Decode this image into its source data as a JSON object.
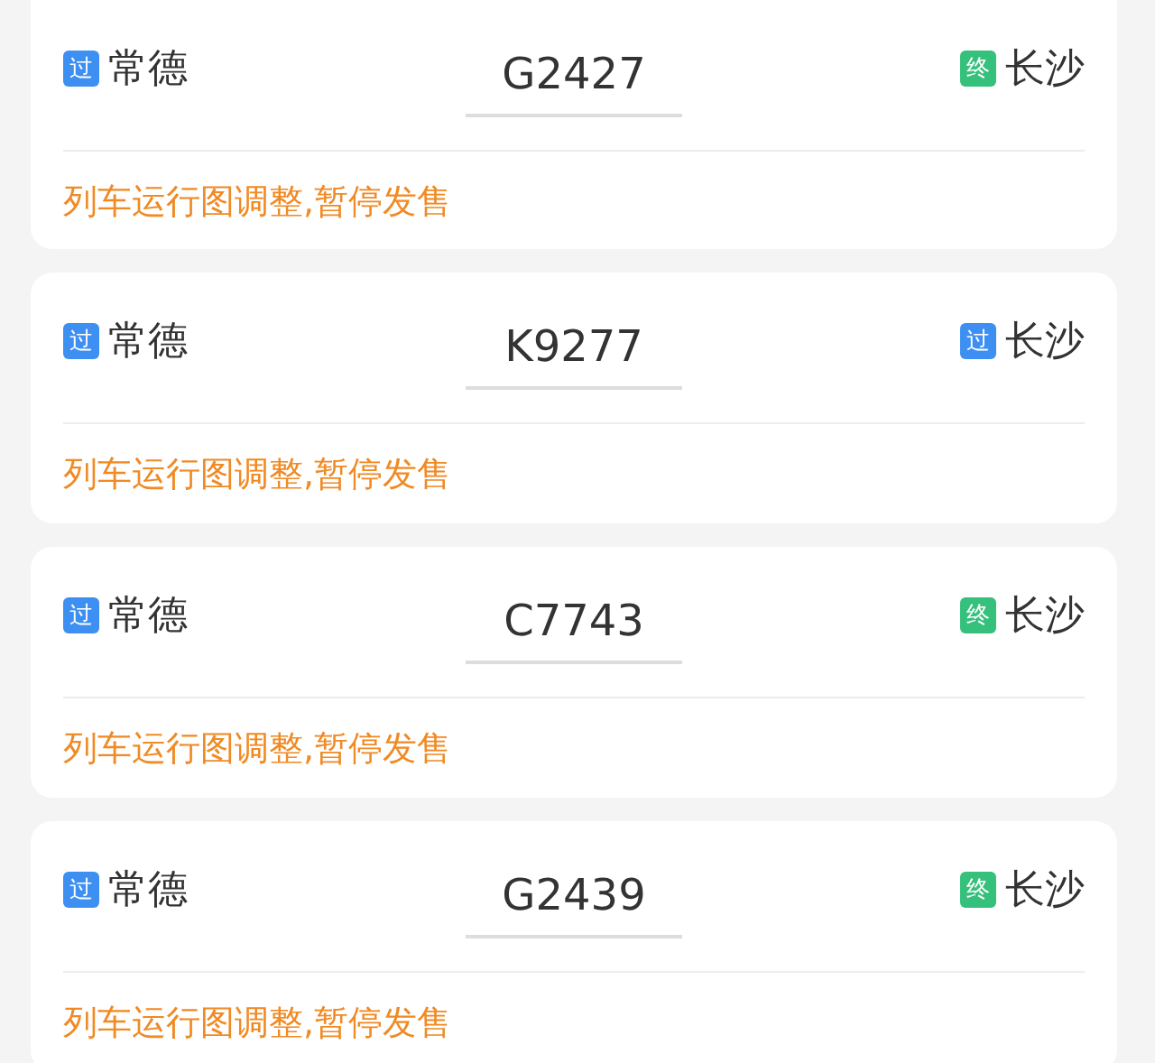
{
  "trains": [
    {
      "from": {
        "badge": "过",
        "kind": "pass",
        "station": "常德"
      },
      "number": "G2427",
      "to": {
        "badge": "终",
        "kind": "terminal",
        "station": "长沙"
      },
      "notice": "列车运行图调整,暂停发售"
    },
    {
      "from": {
        "badge": "过",
        "kind": "pass",
        "station": "常德"
      },
      "number": "K9277",
      "to": {
        "badge": "过",
        "kind": "pass",
        "station": "长沙"
      },
      "notice": "列车运行图调整,暂停发售"
    },
    {
      "from": {
        "badge": "过",
        "kind": "pass",
        "station": "常德"
      },
      "number": "C7743",
      "to": {
        "badge": "终",
        "kind": "terminal",
        "station": "长沙"
      },
      "notice": "列车运行图调整,暂停发售"
    },
    {
      "from": {
        "badge": "过",
        "kind": "pass",
        "station": "常德"
      },
      "number": "G2439",
      "to": {
        "badge": "终",
        "kind": "terminal",
        "station": "长沙"
      },
      "notice": "列车运行图调整,暂停发售"
    }
  ]
}
